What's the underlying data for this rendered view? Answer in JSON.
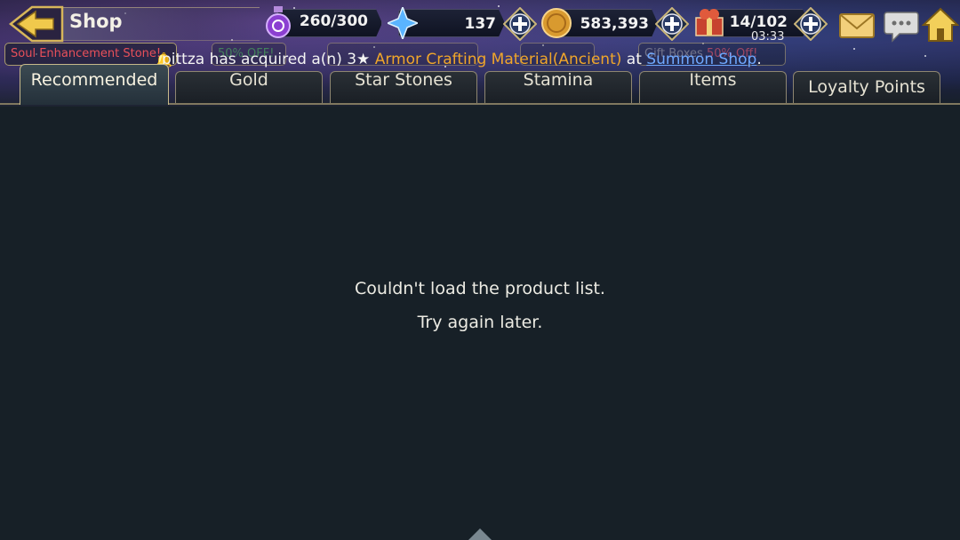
{
  "header": {
    "title": "Shop",
    "timer": "03:33"
  },
  "resources": [
    {
      "name": "stamina",
      "icon": "purple-potion-icon",
      "value": "260/300"
    },
    {
      "name": "crystals",
      "icon": "blue-crystal-icon",
      "value": "137"
    },
    {
      "name": "gold",
      "icon": "gold-coin-icon",
      "value": "583,393"
    },
    {
      "name": "gift-boxes",
      "icon": "gift-box-icon",
      "value": "14/102"
    }
  ],
  "promos": {
    "soul": "Soul Enhancement Stone",
    "soul_suffix": "!",
    "gold_off": "50% OFF!",
    "gift_prefix": "Gift Boxes",
    "gift_off": "50% Off!"
  },
  "ticker": {
    "user": "pittza",
    "text1": " has acquired a(n) 3★ ",
    "item": "Armor Crafting Material(Ancient)",
    "text2": " at ",
    "place": "Summon Shop",
    "text3": "."
  },
  "tabs": [
    {
      "label": "Recommended",
      "active": true
    },
    {
      "label": "Gold",
      "active": false
    },
    {
      "label": "Star Stones",
      "active": false
    },
    {
      "label": "Stamina",
      "active": false
    },
    {
      "label": "Items",
      "active": false
    },
    {
      "label": "Loyalty Points",
      "active": false
    }
  ],
  "content": {
    "error_line1": "Couldn't load the product list.",
    "error_line2": "Try again later."
  },
  "colors": {
    "accent_gold": "#f0a62a",
    "link_blue": "#6fa8ff",
    "promo_red": "#e8505a",
    "promo_green": "#3fb04a",
    "background": "#172027"
  }
}
